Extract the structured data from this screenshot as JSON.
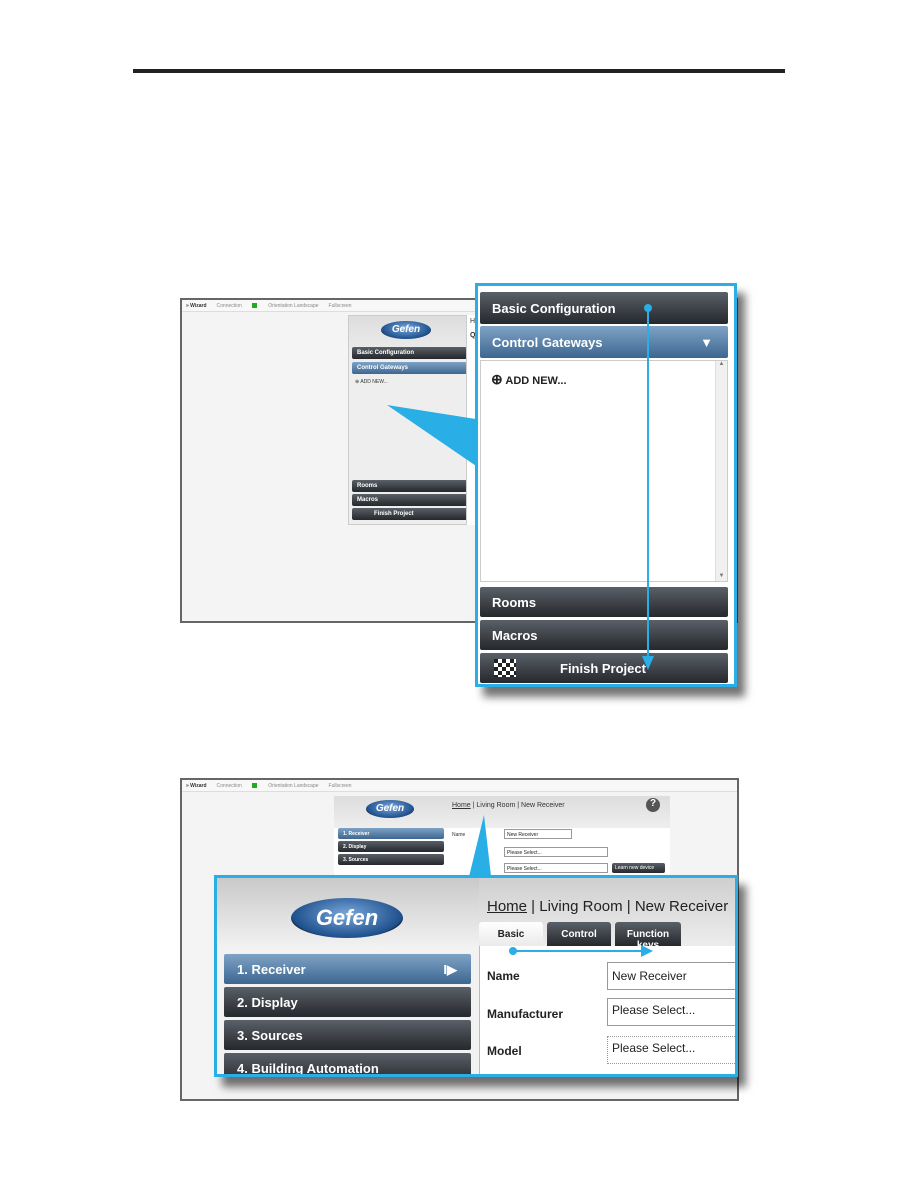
{
  "topbar": {
    "wizard": "» Wizard",
    "connection": "Connection",
    "orientation": "Orientation Landscape",
    "fullscreen": "Fullscreen"
  },
  "logo": "Gefen",
  "shot1": {
    "menu": [
      "Basic Configuration",
      "Control Gateways",
      "Rooms",
      "Macros",
      "Finish Project"
    ],
    "add_new": "ADD NEW...",
    "content_title": "Qui",
    "breadcrumb": "Ho"
  },
  "shot2": {
    "breadcrumb": {
      "home": "Home",
      "rest": " | Living Room | New Receiver"
    },
    "tabs": [
      "Basic",
      "Control",
      "Function keys"
    ],
    "steps": [
      "1. Receiver",
      "2. Display",
      "3. Sources",
      "4. Building Automation"
    ],
    "labels": [
      "Name",
      "Manufacturer",
      "Model"
    ],
    "values": [
      "New Receiver",
      "Please Select...",
      "Please Select..."
    ],
    "learn": "Learn new device",
    "help": "?"
  },
  "colors": {
    "callout": "#29aee6",
    "selected": "#4a76a0"
  }
}
